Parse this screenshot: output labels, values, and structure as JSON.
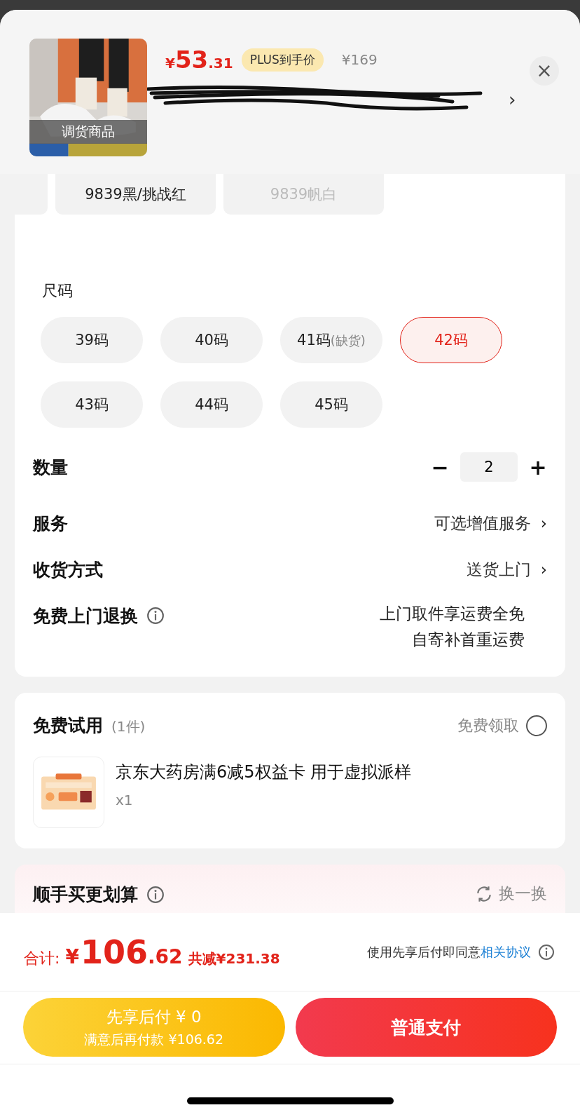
{
  "product": {
    "price_symbol": "¥",
    "price_int": "53",
    "price_dec": ".31",
    "price_badge": "PLUS到手价",
    "original_price": "¥169",
    "image_caption": "调货商品",
    "address_chevron": "›",
    "close_icon": "×"
  },
  "colors": [
    {
      "kind": "cut"
    },
    {
      "kind": "chip",
      "label": "9839黑/挑战红",
      "disabled": false
    },
    {
      "kind": "chip",
      "label": "9839帆白",
      "disabled": true
    }
  ],
  "size": {
    "title": "尺码",
    "options": [
      {
        "label": "39码",
        "selected": false
      },
      {
        "label": "40码",
        "selected": false
      },
      {
        "label": "41码",
        "note": "(缺货)",
        "selected": false
      },
      {
        "label": "42码",
        "selected": true
      },
      {
        "label": "43码",
        "selected": false
      },
      {
        "label": "44码",
        "selected": false
      },
      {
        "label": "45码",
        "selected": false
      }
    ]
  },
  "quantity": {
    "label": "数量",
    "minus": "−",
    "value": "2",
    "plus": "+"
  },
  "rows": [
    {
      "kind": "link",
      "label": "服务",
      "value": "可选增值服务",
      "chevron": "›"
    },
    {
      "kind": "link",
      "label": "收货方式",
      "value": "送货上门",
      "chevron": "›"
    },
    {
      "kind": "info",
      "label": "免费上门退换",
      "lines": [
        "上门取件享运费全免",
        "自寄补首重运费"
      ]
    }
  ],
  "free_trial": {
    "title": "免费试用",
    "count": "(1件)",
    "claim_label": "免费领取",
    "checked": false,
    "item": {
      "kind": "picture",
      "name": "京东大药房满6减5权益卡 用于虚拟派样",
      "qty": "x1"
    }
  },
  "bundle": {
    "title": "顺手买更划算",
    "refresh": "换一换"
  },
  "footer": {
    "total_label": "合计:",
    "total_symbol": "¥",
    "total_int": "106",
    "total_dec": ".62",
    "saved": "共减¥231.38",
    "agree_text": "使用先享后付即同意",
    "agree_link": "相关协议",
    "later_title": "先享后付 ¥ 0",
    "later_sub": "满意后再付款 ¥106.62",
    "pay_label": "普通支付"
  }
}
